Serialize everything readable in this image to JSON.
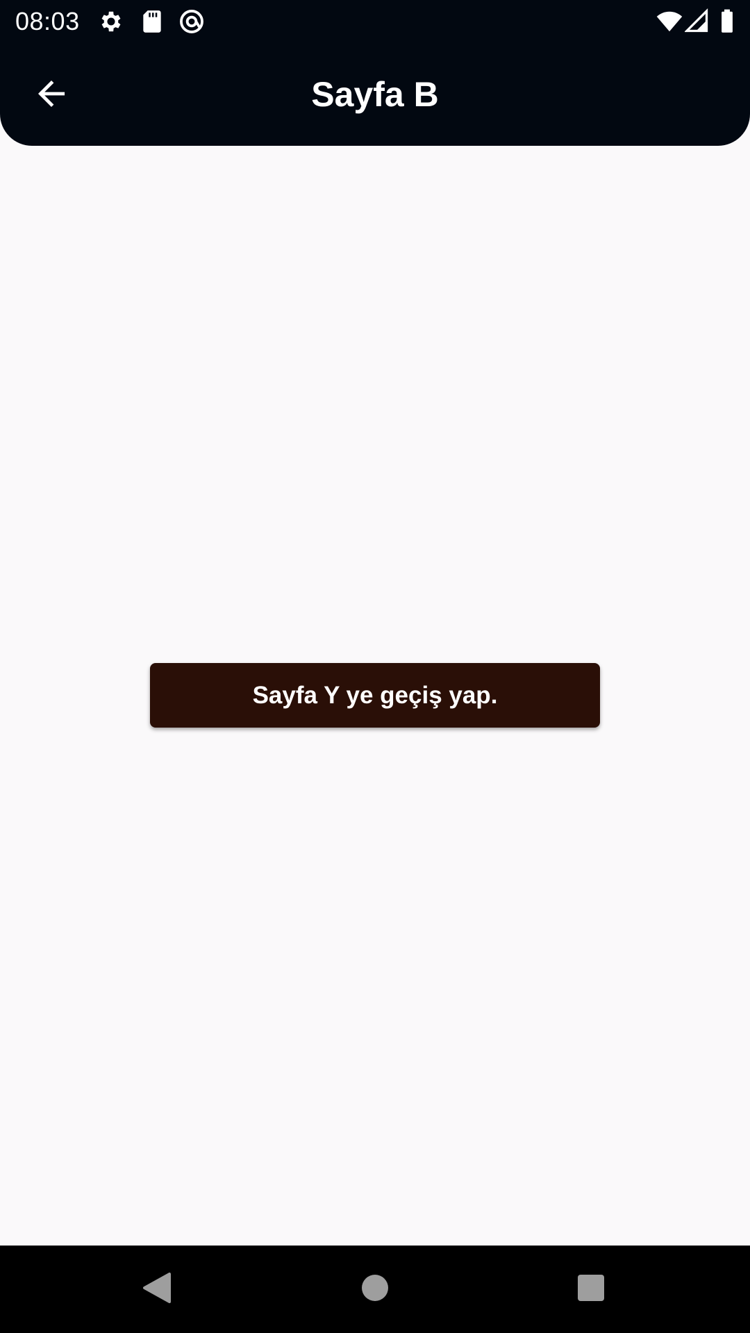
{
  "status_bar": {
    "time": "08:03",
    "icons_left": [
      "gear-icon",
      "sd-card-icon",
      "at-sign-icon"
    ],
    "icons_right": [
      "wifi-icon",
      "signal-icon",
      "battery-icon"
    ]
  },
  "app_bar": {
    "title": "Sayfa B",
    "back_icon": "arrow-left-icon"
  },
  "main": {
    "button_label": "Sayfa Y ye geçiş yap."
  },
  "nav_bar": {
    "items": [
      "back-triangle-icon",
      "home-circle-icon",
      "recents-square-icon"
    ]
  },
  "colors": {
    "app_bar_bg": "#020811",
    "page_bg": "#faf9fa",
    "button_bg": "#2a0f07",
    "nav_bg": "#000000"
  }
}
